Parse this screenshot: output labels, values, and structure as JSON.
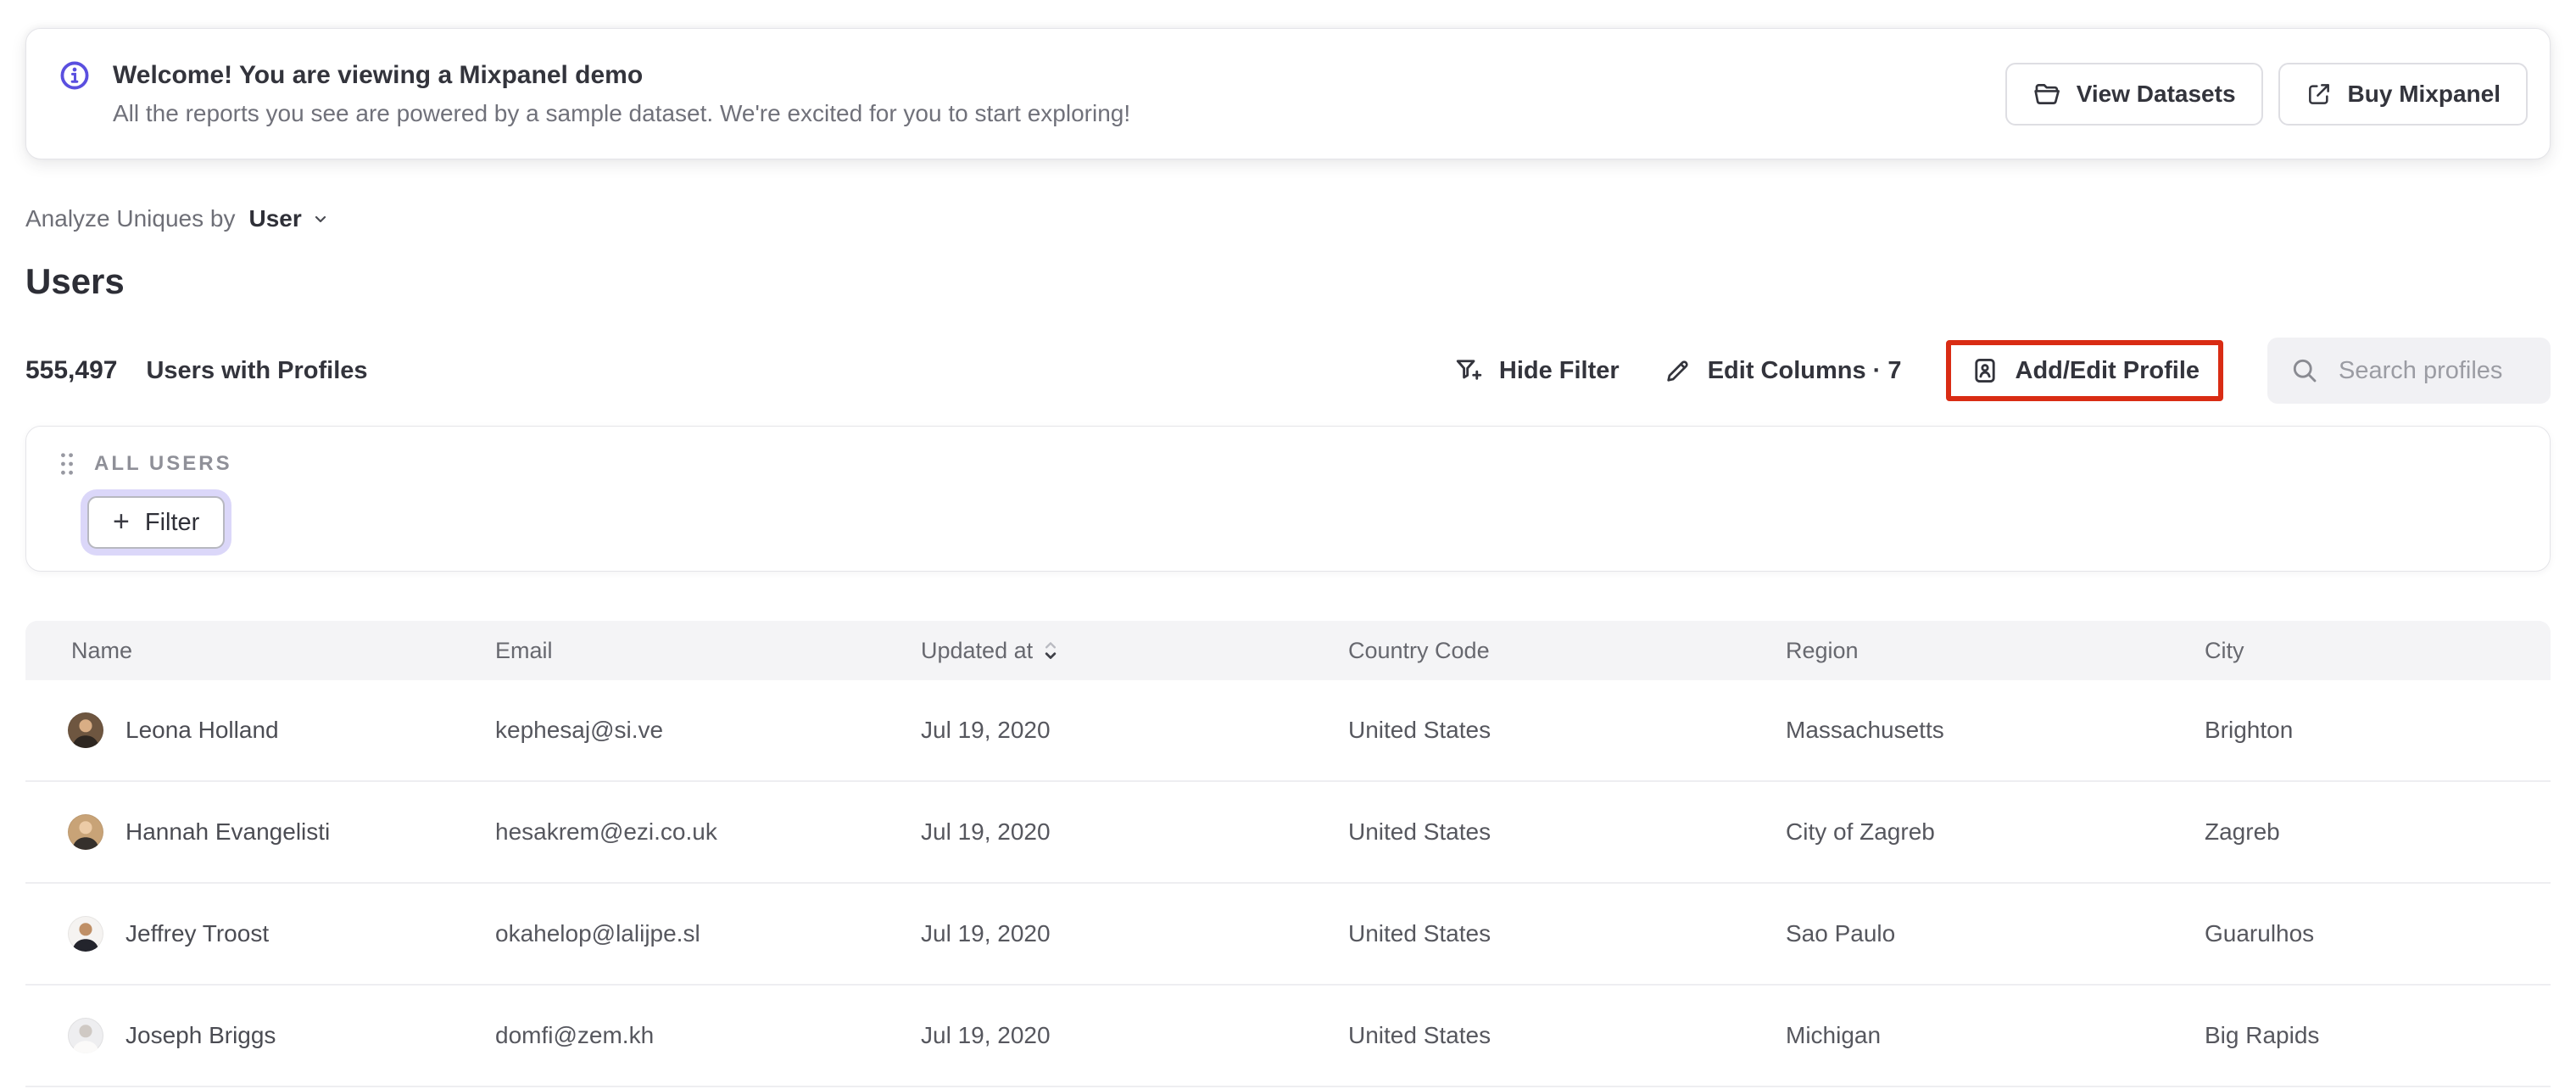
{
  "banner": {
    "title": "Welcome! You are viewing a Mixpanel demo",
    "subtitle": "All the reports you see are powered by a sample dataset. We're excited for you to start exploring!",
    "view_datasets_label": "View Datasets",
    "buy_mixpanel_label": "Buy Mixpanel"
  },
  "controls": {
    "analyze_label": "Analyze Uniques by",
    "analyze_value": "User"
  },
  "page": {
    "title": "Users"
  },
  "stats": {
    "count": "555,497",
    "label": "Users with Profiles"
  },
  "toolbar": {
    "hide_filter_label": "Hide Filter",
    "edit_columns_label": "Edit Columns · 7",
    "add_edit_profile_label": "Add/Edit Profile",
    "search_placeholder": "Search profiles",
    "highlight_color": "#d92c14"
  },
  "filter_section": {
    "group_label": "ALL USERS",
    "filter_button_label": "Filter"
  },
  "colors": {
    "accent_purple": "#5a4fdf",
    "focus_ring": "#dbd7f9",
    "annotation_red": "#d92c14"
  },
  "table": {
    "columns": [
      "Name",
      "Email",
      "Updated at",
      "Country Code",
      "Region",
      "City"
    ],
    "sorted_column": "Updated at",
    "rows": [
      {
        "name": "Leona Holland",
        "email": "kephesaj@si.ve",
        "updated_at": "Jul 19, 2020",
        "country_code": "United States",
        "region": "Massachusetts",
        "city": "Brighton",
        "avatar": {
          "bg": "#6e5640",
          "head": "#d9ae85",
          "body": "#2e2721"
        }
      },
      {
        "name": "Hannah Evangelisti",
        "email": "hesakrem@ezi.co.uk",
        "updated_at": "Jul 19, 2020",
        "country_code": "United States",
        "region": "City of Zagreb",
        "city": "Zagreb",
        "avatar": {
          "bg": "#c8a377",
          "head": "#eccba6",
          "body": "#35302c"
        }
      },
      {
        "name": "Jeffrey Troost",
        "email": "okahelop@lalijpe.sl",
        "updated_at": "Jul 19, 2020",
        "country_code": "United States",
        "region": "Sao Paulo",
        "city": "Guarulhos",
        "avatar": {
          "bg": "#f5f3f1",
          "head": "#bf8f66",
          "body": "#23242c"
        }
      },
      {
        "name": "Joseph Briggs",
        "email": "domfi@zem.kh",
        "updated_at": "Jul 19, 2020",
        "country_code": "United States",
        "region": "Michigan",
        "city": "Big Rapids",
        "avatar": {
          "bg": "#eeeef0",
          "head": "#cfc9c4",
          "body": "#fbfaf9"
        }
      }
    ]
  }
}
